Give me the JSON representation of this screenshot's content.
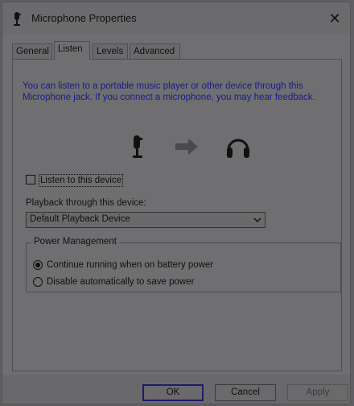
{
  "window": {
    "title": "Microphone Properties",
    "close_label": "✕",
    "icon": "microphone-icon"
  },
  "tabs": [
    {
      "label": "General",
      "active": false
    },
    {
      "label": "Listen",
      "active": true
    },
    {
      "label": "Levels",
      "active": false
    },
    {
      "label": "Advanced",
      "active": false
    }
  ],
  "listen": {
    "description": "You can listen to a portable music player or other device through this Microphone jack.  If you connect a microphone, you may hear feedback.",
    "illustration_icons": [
      "microphone-icon",
      "arrow-right-icon",
      "headphones-icon"
    ],
    "listen_checkbox_label": "Listen to this device",
    "listen_checked": false,
    "playback_label": "Playback through this device:",
    "playback_device": "Default Playback Device"
  },
  "power": {
    "legend": "Power Management",
    "option_continue": "Continue running when on battery power",
    "option_disable": "Disable automatically to save power",
    "selected": "continue"
  },
  "buttons": {
    "ok": "OK",
    "cancel": "Cancel",
    "apply": "Apply"
  }
}
